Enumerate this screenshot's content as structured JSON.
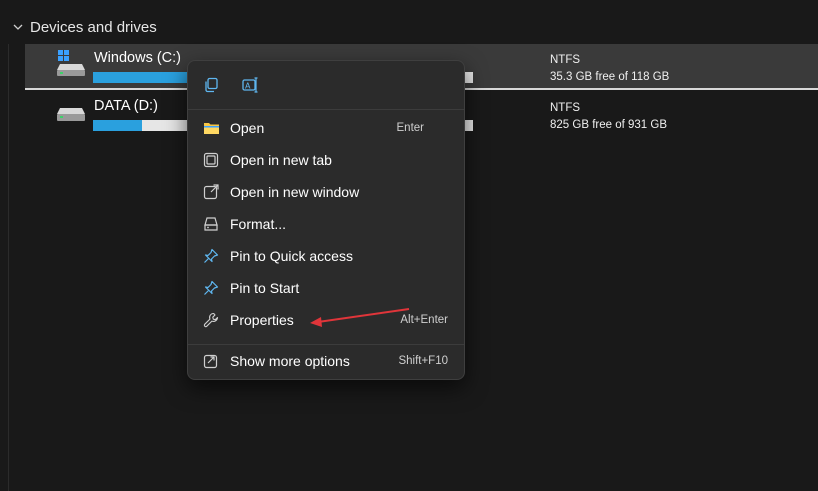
{
  "section": {
    "title": "Devices and drives"
  },
  "drives": [
    {
      "name": "Windows (C:)",
      "filesystem": "NTFS",
      "free_text": "35.3 GB free of 118 GB",
      "used_fraction": 0.7
    },
    {
      "name": "DATA (D:)",
      "filesystem": "NTFS",
      "free_text": "825 GB free of 931 GB",
      "used_fraction": 0.13
    }
  ],
  "context_menu": {
    "toolbar": [
      {
        "icon": "copy-icon"
      },
      {
        "icon": "rename-icon"
      }
    ],
    "items": [
      {
        "label": "Open",
        "shortcut": "Enter",
        "icon": "folder-icon"
      },
      {
        "label": "Open in new tab",
        "shortcut": "",
        "icon": "new-tab-icon"
      },
      {
        "label": "Open in new window",
        "shortcut": "",
        "icon": "new-window-icon"
      },
      {
        "label": "Format...",
        "shortcut": "",
        "icon": "format-icon"
      },
      {
        "label": "Pin to Quick access",
        "shortcut": "",
        "icon": "pin-icon"
      },
      {
        "label": "Pin to Start",
        "shortcut": "",
        "icon": "pin-icon"
      },
      {
        "label": "Properties",
        "shortcut": "Alt+Enter",
        "icon": "wrench-icon"
      },
      {
        "label": "Show more options",
        "shortcut": "Shift+F10",
        "icon": "share-icon"
      }
    ]
  },
  "colors": {
    "accent": "#2aa0de",
    "annotation_arrow": "#e0353a",
    "menu_background": "#2b2b2b",
    "page_background": "#191919"
  }
}
